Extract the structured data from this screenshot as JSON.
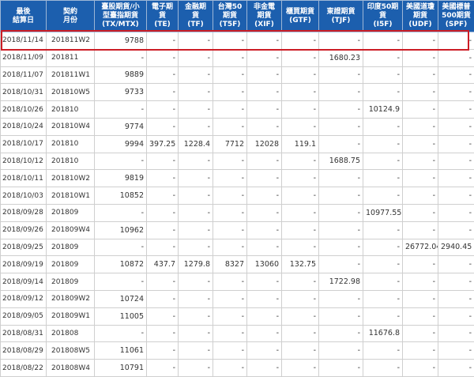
{
  "table": {
    "headers": [
      [
        "最後",
        "結算日"
      ],
      [
        "契約",
        "月份"
      ],
      [
        "臺股期貨/小",
        "型臺指期貨",
        "(TX/MTX)"
      ],
      [
        "電子期",
        "貨",
        "(TE)"
      ],
      [
        "金融期",
        "貨",
        "(TF)"
      ],
      [
        "台灣50",
        "期貨",
        "(T5F)"
      ],
      [
        "非金電",
        "期貨",
        "(XIF)"
      ],
      [
        "櫃買期貨",
        "(GTF)"
      ],
      [
        "東證期貨",
        "(TJF)"
      ],
      [
        "印度50期",
        "貨",
        "(I5F)"
      ],
      [
        "美國道瓊",
        "期貨",
        "(UDF)"
      ],
      [
        "美國標普",
        "500期貨",
        "(SPF)"
      ]
    ],
    "rows": [
      [
        "2018/11/14",
        "201811W2",
        "9788",
        "-",
        "-",
        "-",
        "-",
        "-",
        "-",
        "-",
        "-",
        "-"
      ],
      [
        "2018/11/09",
        "201811",
        "-",
        "-",
        "-",
        "-",
        "-",
        "-",
        "1680.23",
        "-",
        "-",
        "-"
      ],
      [
        "2018/11/07",
        "201811W1",
        "9889",
        "-",
        "-",
        "-",
        "-",
        "-",
        "-",
        "-",
        "-",
        "-"
      ],
      [
        "2018/10/31",
        "201810W5",
        "9733",
        "-",
        "-",
        "-",
        "-",
        "-",
        "-",
        "-",
        "-",
        "-"
      ],
      [
        "2018/10/26",
        "201810",
        "-",
        "-",
        "-",
        "-",
        "-",
        "-",
        "-",
        "10124.9",
        "-",
        "-"
      ],
      [
        "2018/10/24",
        "201810W4",
        "9774",
        "-",
        "-",
        "-",
        "-",
        "-",
        "-",
        "-",
        "-",
        "-"
      ],
      [
        "2018/10/17",
        "201810",
        "9994",
        "397.25",
        "1228.4",
        "7712",
        "12028",
        "119.1",
        "-",
        "-",
        "-",
        "-"
      ],
      [
        "2018/10/12",
        "201810",
        "-",
        "-",
        "-",
        "-",
        "-",
        "-",
        "1688.75",
        "-",
        "-",
        "-"
      ],
      [
        "2018/10/11",
        "201810W2",
        "9819",
        "-",
        "-",
        "-",
        "-",
        "-",
        "-",
        "-",
        "-",
        "-"
      ],
      [
        "2018/10/03",
        "201810W1",
        "10852",
        "-",
        "-",
        "-",
        "-",
        "-",
        "-",
        "-",
        "-",
        "-"
      ],
      [
        "2018/09/28",
        "201809",
        "-",
        "-",
        "-",
        "-",
        "-",
        "-",
        "-",
        "10977.55",
        "-",
        "-"
      ],
      [
        "2018/09/26",
        "201809W4",
        "10962",
        "-",
        "-",
        "-",
        "-",
        "-",
        "-",
        "-",
        "-",
        "-"
      ],
      [
        "2018/09/25",
        "201809",
        "-",
        "-",
        "-",
        "-",
        "-",
        "-",
        "-",
        "-",
        "26772.04",
        "2940.45"
      ],
      [
        "2018/09/19",
        "201809",
        "10872",
        "437.7",
        "1279.8",
        "8327",
        "13060",
        "132.75",
        "-",
        "-",
        "-",
        "-"
      ],
      [
        "2018/09/14",
        "201809",
        "-",
        "-",
        "-",
        "-",
        "-",
        "-",
        "1722.98",
        "-",
        "-",
        "-"
      ],
      [
        "2018/09/12",
        "201809W2",
        "10724",
        "-",
        "-",
        "-",
        "-",
        "-",
        "-",
        "-",
        "-",
        "-"
      ],
      [
        "2018/09/05",
        "201809W1",
        "11005",
        "-",
        "-",
        "-",
        "-",
        "-",
        "-",
        "-",
        "-",
        "-"
      ],
      [
        "2018/08/31",
        "201808",
        "-",
        "-",
        "-",
        "-",
        "-",
        "-",
        "-",
        "11676.8",
        "-",
        "-"
      ],
      [
        "2018/08/29",
        "201808W5",
        "11061",
        "-",
        "-",
        "-",
        "-",
        "-",
        "-",
        "-",
        "-",
        "-"
      ],
      [
        "2018/08/22",
        "201808W4",
        "10791",
        "-",
        "-",
        "-",
        "-",
        "-",
        "-",
        "-",
        "-",
        "-"
      ]
    ]
  },
  "highlight": {
    "row_index": 0,
    "color": "#cc1d25"
  },
  "colors": {
    "header_bg": "#1c5fae",
    "header_text": "#ffffff",
    "cell_text": "#333333",
    "border": "#cfcfcf"
  }
}
